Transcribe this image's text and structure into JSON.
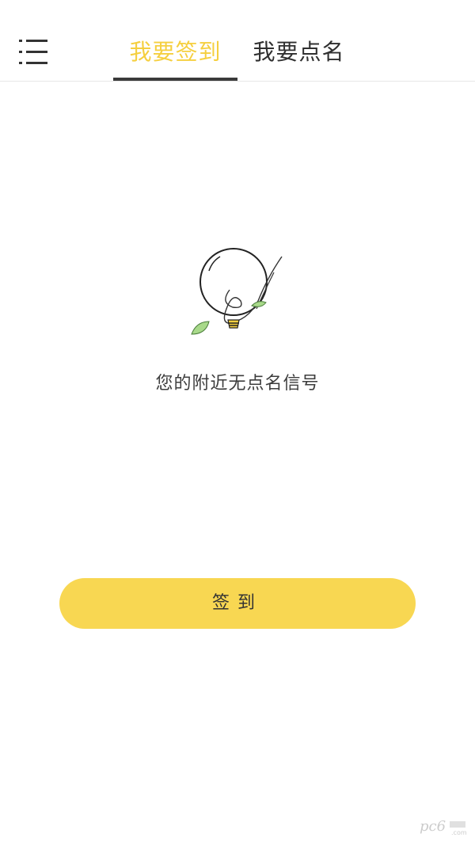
{
  "header": {
    "tabs": [
      {
        "label": "我要签到",
        "active": true
      },
      {
        "label": "我要点名",
        "active": false
      }
    ],
    "active_color": "#f5cf3f",
    "menu_icon": "list-menu-icon"
  },
  "empty_state": {
    "illustration": "lightbulb-with-leaves-icon",
    "message": "您的附近无点名信号"
  },
  "actions": {
    "checkin_label": "签到",
    "button_color": "#f8d752"
  }
}
